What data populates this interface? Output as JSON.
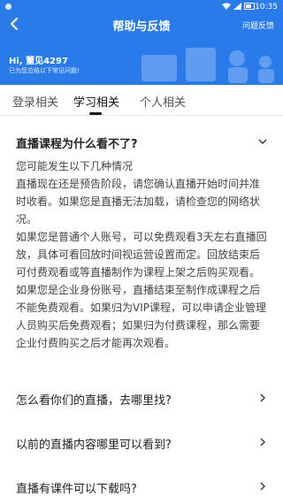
{
  "status": {
    "time": "10:35"
  },
  "header": {
    "title": "帮助与反馈",
    "right_action": "问题反馈",
    "greeting": "Hi, 董见4297",
    "subtitle": "已为您总结以下常见问题!"
  },
  "tabs": [
    {
      "label": "登录相关",
      "active": false
    },
    {
      "label": "学习相关",
      "active": true
    },
    {
      "label": "个人相关",
      "active": false
    }
  ],
  "faq": {
    "expanded": {
      "question": "直播课程为什么看不了?",
      "answer_lines": [
        "您可能发生以下几种情况",
        "直播现在还是预告阶段，请您确认直播开始时间并准",
        "时收看。如果您是直播无法加载，请检查您的网络状",
        "况。",
        "如果您是普通个人账号，可以免费观看3天左右直播回",
        "放，具体可看回放时间视运营设置而定。回放结束后",
        "可付费观看或等直播制作为课程上架之后购买观看。",
        "如果您是企业身份账号，直播结束至制作成课程之后",
        "不能免费观看。如果归为VIP课程，可以申请企业管理",
        "人员购买后免费观看；如果归为付费课程，那么需要",
        "企业付费购买之后才能再次观看。"
      ]
    },
    "items": [
      {
        "question": "怎么看你们的直播，去哪里找?"
      },
      {
        "question": "以前的直播内容哪里可以看到?"
      },
      {
        "question": "直播有课件可以下载吗?"
      }
    ]
  },
  "colors": {
    "header_bg": "#2a7bea",
    "text": "#222222"
  }
}
